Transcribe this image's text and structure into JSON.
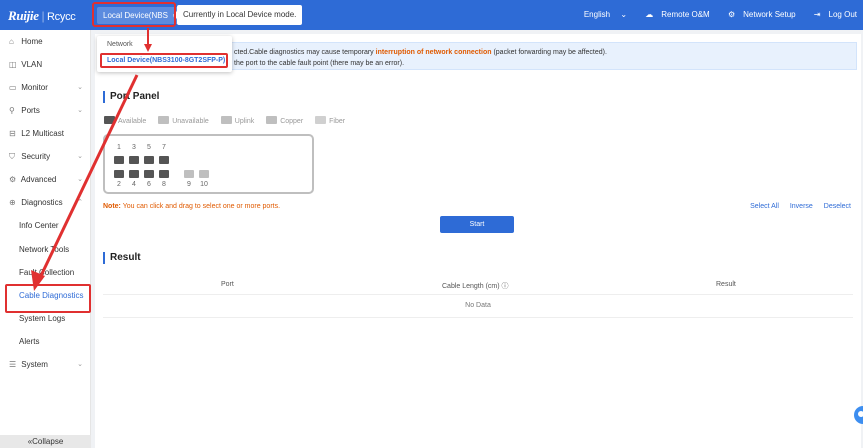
{
  "header": {
    "logo_brand": "Ruijie",
    "logo_sub": "Rcycc",
    "device_selector": "Local Device(NBS",
    "mode_tip": "Currently in Local Device mode.",
    "language": "English",
    "remote_om": "Remote O&M",
    "network_setup": "Network Setup",
    "logout": "Log Out"
  },
  "dropdown": {
    "header": "Network",
    "item": "Local Device(NBS3100-8GT2SFP-P)"
  },
  "sidebar": {
    "items": [
      {
        "label": "Home",
        "icon": "home-icon"
      },
      {
        "label": "VLAN",
        "icon": "vlan-icon"
      },
      {
        "label": "Monitor",
        "icon": "monitor-icon"
      },
      {
        "label": "Ports",
        "icon": "ports-icon"
      },
      {
        "label": "L2 Multicast",
        "icon": "multicast-icon"
      },
      {
        "label": "Security",
        "icon": "shield-icon"
      },
      {
        "label": "Advanced",
        "icon": "advanced-icon"
      },
      {
        "label": "Diagnostics",
        "icon": "diagnostics-icon"
      },
      {
        "label": "Info Center"
      },
      {
        "label": "Network Tools"
      },
      {
        "label": "Fault Collection"
      },
      {
        "label": "Cable Diagnostics"
      },
      {
        "label": "System Logs"
      },
      {
        "label": "Alerts"
      },
      {
        "label": "System",
        "icon": "system-icon"
      }
    ],
    "collapse": "«Collapse"
  },
  "notice": {
    "part1": "cted.Cable diagnostics may cause temporary ",
    "highlight": "interruption of network connection",
    "part2": " (packet forwarding may be affected).",
    "line2": "the port to the cable fault point (there may be an error)."
  },
  "port_panel": {
    "title": "Port Panel",
    "legend": [
      "Available",
      "Unavailable",
      "Uplink",
      "Copper",
      "Fiber"
    ],
    "top_numbers": [
      "1",
      "3",
      "5",
      "7"
    ],
    "bottom_numbers": [
      "2",
      "4",
      "6",
      "8",
      "9",
      "10"
    ],
    "note_label": "Note:",
    "note_text": " You can click and drag to select one or more ports.",
    "select_all": "Select All",
    "inverse": "Inverse",
    "deselect": "Deselect",
    "start": "Start"
  },
  "result": {
    "title": "Result",
    "columns": [
      "Port",
      "Cable Length (cm) ⓘ",
      "Result"
    ],
    "empty": "No Data"
  },
  "colors": {
    "brand": "#2e6bd6",
    "highlight": "#e05a00",
    "annotation_red": "#e03030"
  }
}
